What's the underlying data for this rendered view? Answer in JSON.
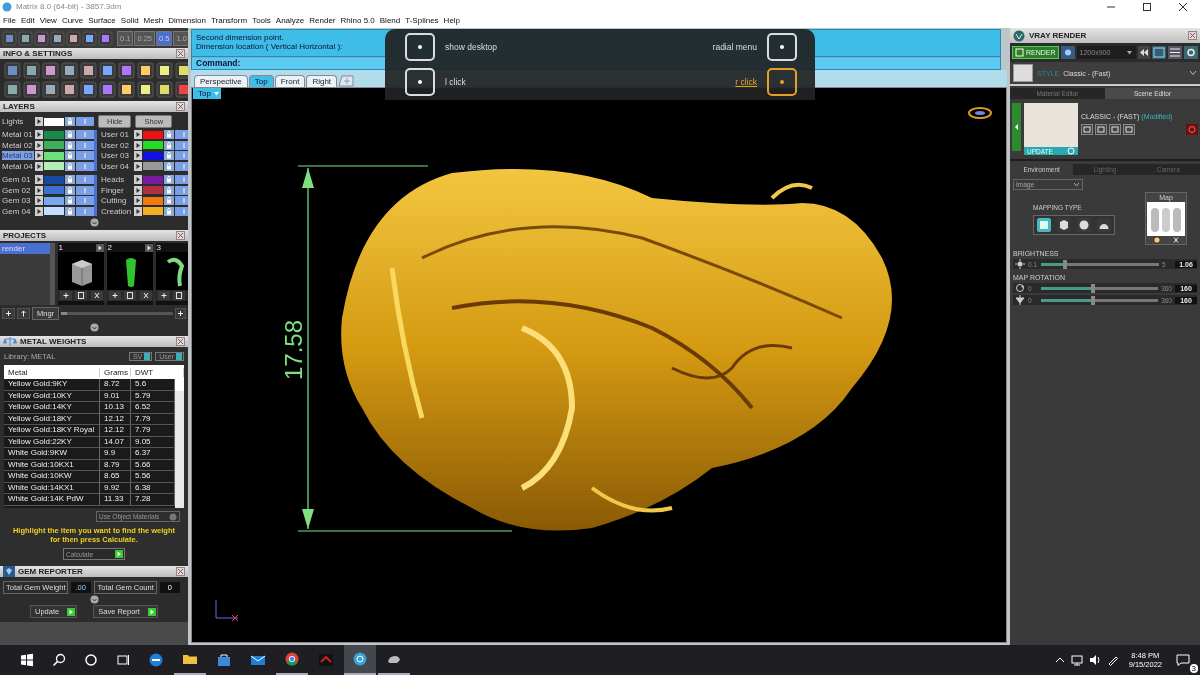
{
  "window": {
    "title": "Matrix 8.0 (64-bit) - 3857.3dm"
  },
  "menu": [
    "File",
    "Edit",
    "View",
    "Curve",
    "Surface",
    "Solid",
    "Mesh",
    "Dimension",
    "Transform",
    "Tools",
    "Analyze",
    "Render",
    "Rhino 5.0",
    "Blend",
    "T-Splines",
    "Help"
  ],
  "snap_values": [
    {
      "label": "0.1",
      "selected": false
    },
    {
      "label": "0.25",
      "selected": false
    },
    {
      "label": "0.5",
      "selected": true
    },
    {
      "label": "1.0",
      "selected": false
    }
  ],
  "info_settings": {
    "title": "INFO & SETTINGS"
  },
  "layers": {
    "title": "LAYERS",
    "lights": {
      "label": "Lights",
      "color": "#ffffff",
      "selected": false
    },
    "hide": "Hide",
    "show": "Show",
    "left": [
      {
        "label": "Metal 01",
        "color": "#1a8a4a",
        "selected": false
      },
      {
        "label": "Metal 02",
        "color": "#3cb05a",
        "selected": false
      },
      {
        "label": "Metal 03",
        "color": "#6ee07a",
        "selected": true
      },
      {
        "label": "Metal 04",
        "color": "#b4f0b4",
        "selected": false
      },
      {
        "label": "Gem 01",
        "color": "#1a4aa0",
        "selected": false
      },
      {
        "label": "Gem 02",
        "color": "#3a70d0",
        "selected": false
      },
      {
        "label": "Gem 03",
        "color": "#7aa8f0",
        "selected": false
      },
      {
        "label": "Gem 04",
        "color": "#c4dcff",
        "selected": false
      }
    ],
    "right": [
      {
        "label": "User 01",
        "color": "#ee1111",
        "selected": false
      },
      {
        "label": "User 02",
        "color": "#22dd22",
        "selected": false
      },
      {
        "label": "User 03",
        "color": "#1111dd",
        "selected": false
      },
      {
        "label": "User 04",
        "color": "#999999",
        "selected": false
      },
      {
        "label": "Heads",
        "color": "#7a1aa0",
        "selected": false
      },
      {
        "label": "Finger",
        "color": "#b03040",
        "selected": false
      },
      {
        "label": "Cutting",
        "color": "#f07a10",
        "selected": false
      },
      {
        "label": "Creation",
        "color": "#f0b020",
        "selected": false
      }
    ]
  },
  "projects": {
    "title": "PROJECTS",
    "items": [
      {
        "label": "render",
        "selected": true
      }
    ],
    "thumbnails": [
      {
        "number": "1",
        "kind": "box"
      },
      {
        "number": "2",
        "kind": "gem"
      },
      {
        "number": "3",
        "kind": "ring"
      }
    ],
    "manager": "Mngr"
  },
  "metal_weights": {
    "title": "METAL WEIGHTS",
    "library": "Library: METAL",
    "toggles": [
      "SV",
      "User"
    ],
    "columns": [
      "Metal",
      "Grams",
      "DWT"
    ],
    "rows": [
      [
        "Yellow Gold:9KY",
        "8.72",
        "5.6"
      ],
      [
        "Yellow Gold:10KY",
        "9.01",
        "5.79"
      ],
      [
        "Yellow Gold:14KY",
        "10.13",
        "6.52"
      ],
      [
        "Yellow Gold:18KY",
        "12.12",
        "7.79"
      ],
      [
        "Yellow Gold:18KY Royal",
        "12.12",
        "7.79"
      ],
      [
        "Yellow Gold:22KY",
        "14.07",
        "9.05"
      ],
      [
        "White Gold:9KW",
        "9.9",
        "6.37"
      ],
      [
        "White Gold:10KX1",
        "8.79",
        "5.66"
      ],
      [
        "White Gold:10KW",
        "8.65",
        "5.56"
      ],
      [
        "White Gold:14KX1",
        "9.92",
        "6.38"
      ],
      [
        "White Gold:14K PdW",
        "11.33",
        "7.28"
      ]
    ],
    "materials": "Use Object Materials",
    "hint": "Highlight the item you want to find the weight for then press Calculate.",
    "calculate": "Calculate"
  },
  "gem_reporter": {
    "title": "GEM REPORTER",
    "weight_label": "Total Gem Weight",
    "weight": ".00",
    "count_label": "Total Gem Count",
    "count": "0",
    "buttons": [
      "Update",
      "Save Report"
    ]
  },
  "command": {
    "lines": [
      "Second dimension point.",
      "Dimension location ( Vertical  Horizontal ):"
    ],
    "prompt": "Command:"
  },
  "view_tabs": [
    {
      "label": "Perspective",
      "selected": false
    },
    {
      "label": "Top",
      "selected": true
    },
    {
      "label": "Front",
      "selected": false
    },
    {
      "label": "Right",
      "selected": false
    }
  ],
  "viewport": {
    "label": "Top",
    "dimension": "17.58"
  },
  "overlay": {
    "rows": [
      {
        "left": {
          "label": "show desktop",
          "highlighted": false
        },
        "right": {
          "label": "radial menu",
          "highlighted": false
        }
      },
      {
        "left": {
          "label": "l click",
          "highlighted": false
        },
        "right": {
          "label": "r click",
          "highlighted": true
        }
      }
    ]
  },
  "vray": {
    "title": "VRAY RENDER",
    "render": "RENDER",
    "resolution": "1200x900",
    "style_label": "STYLE",
    "style": "Classic - (Fast)",
    "tabs": [
      {
        "label": "Material Editor",
        "selected": false
      },
      {
        "label": "Scene Editor",
        "selected": true
      }
    ],
    "preset": "CLASSIC - (FAST)",
    "modified": "(Modified)",
    "update": "UPDATE",
    "env_tabs": [
      {
        "label": "Environment",
        "selected": true
      },
      {
        "label": "Lighting",
        "selected": false
      },
      {
        "label": "Camera",
        "selected": false
      }
    ],
    "env_type": "Image",
    "mapping_title": "MAPPING TYPE",
    "mapping": [
      {
        "kind": "plane",
        "selected": true
      },
      {
        "kind": "cube",
        "selected": false
      },
      {
        "kind": "sphere",
        "selected": false
      },
      {
        "kind": "dome",
        "selected": false
      }
    ],
    "map": "Map",
    "sliders": [
      {
        "title": "BRIGHTNESS",
        "kind": "sun",
        "min": "0.1",
        "max": "5",
        "value": "1.06",
        "level": 0.2
      },
      {
        "title": "MAP ROTATION",
        "kind": "rotate",
        "min": "0",
        "max": "360",
        "value": "160",
        "level": 0.44
      },
      {
        "kind": "flip",
        "min": "0",
        "max": "360",
        "value": "160",
        "level": 0.44
      }
    ]
  },
  "taskbar": {
    "apps": [
      {
        "kind": "edge",
        "open": false
      },
      {
        "kind": "folder",
        "open": true
      },
      {
        "kind": "store",
        "open": false
      },
      {
        "kind": "mail",
        "open": false
      },
      {
        "kind": "chrome",
        "open": true
      },
      {
        "kind": "game",
        "open": false
      },
      {
        "kind": "matrix",
        "open": true
      },
      {
        "kind": "rhino",
        "open": true
      }
    ],
    "time": "8:48 PM",
    "date": "9/15/2022",
    "notifications": "3"
  }
}
